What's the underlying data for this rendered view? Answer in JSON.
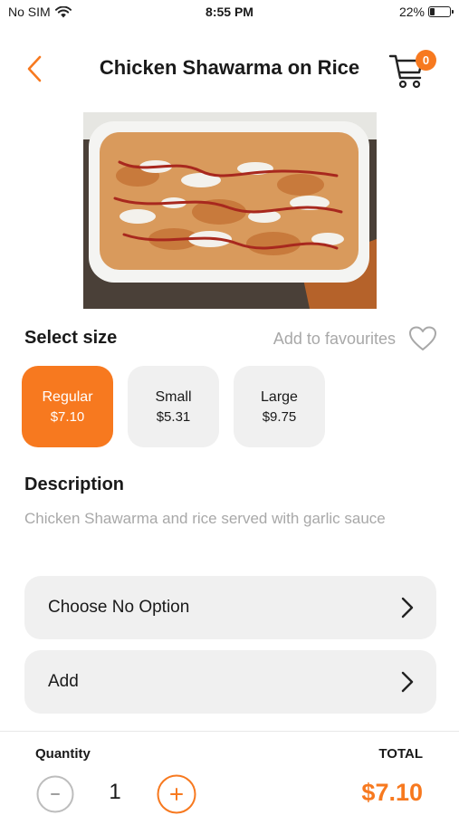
{
  "status_bar": {
    "carrier": "No SIM",
    "time": "8:55 PM",
    "battery": "22%",
    "battery_level": 0.22
  },
  "header": {
    "title": "Chicken Shawarma on Rice",
    "cart_count": "0"
  },
  "size_section": {
    "title": "Select size",
    "favourite_label": "Add to favourites",
    "options": [
      {
        "name": "Regular",
        "price": "$7.10",
        "selected": true
      },
      {
        "name": "Small",
        "price": "$5.31",
        "selected": false
      },
      {
        "name": "Large",
        "price": "$9.75",
        "selected": false
      }
    ]
  },
  "description": {
    "title": "Description",
    "text": "Chicken Shawarma and rice served with garlic sauce"
  },
  "options": [
    {
      "label": "Choose No Option"
    },
    {
      "label": "Add"
    }
  ],
  "footer": {
    "quantity_label": "Quantity",
    "quantity": "1",
    "total_label": "TOTAL",
    "total": "$7.10"
  },
  "colors": {
    "accent": "#f7791f",
    "card_background": "#f0f0f0",
    "muted_text": "#a8a8a8"
  }
}
